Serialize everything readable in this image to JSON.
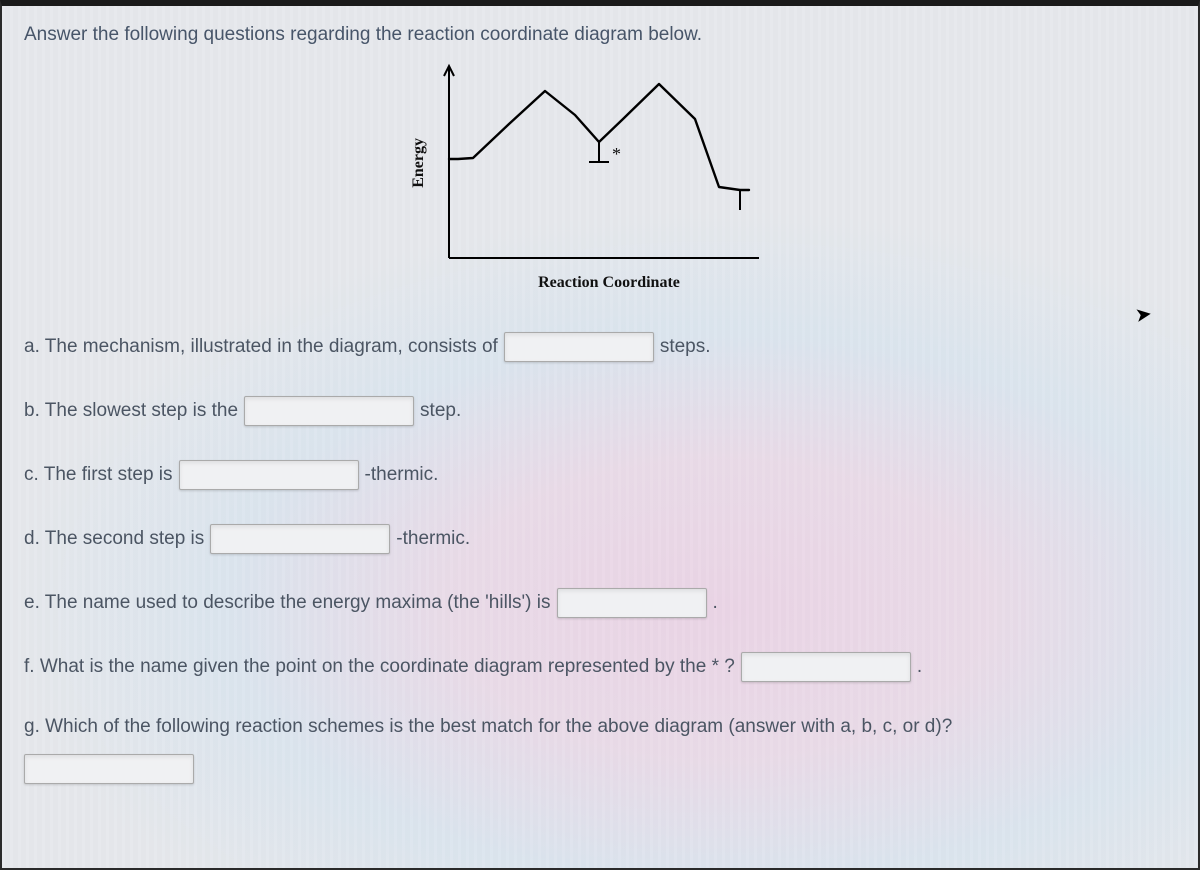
{
  "prompt": "Answer the following questions regarding the reaction coordinate diagram below.",
  "chart_data": {
    "type": "line",
    "xlabel": "Reaction Coordinate",
    "ylabel": "Energy",
    "x": [
      0,
      3,
      8,
      20,
      32,
      42,
      50,
      58,
      70,
      82,
      90,
      97,
      100
    ],
    "values": [
      55,
      55,
      56,
      75,
      93,
      80,
      65,
      78,
      97,
      78,
      40,
      38,
      38
    ],
    "annotations": [
      {
        "label": "*",
        "x": 50,
        "y": 65
      }
    ],
    "intermediate_tick_x": 50,
    "intermediate_tick_y_top": 65,
    "products_tick_x": 97,
    "products_tick_y": 38
  },
  "questions": {
    "a": {
      "pre": "a. The mechanism, illustrated in the diagram, consists of",
      "post": "steps."
    },
    "b": {
      "pre": "b. The slowest step is the",
      "post": "step."
    },
    "c": {
      "pre": "c. The first step is",
      "post": "-thermic."
    },
    "d": {
      "pre": "d. The second step is",
      "post": "-thermic."
    },
    "e": {
      "pre": "e. The name used to describe the energy maxima (the 'hills') is",
      "post": "."
    },
    "f": {
      "pre": "f. What is the name given the point on the coordinate diagram represented by the * ?",
      "post": "."
    },
    "g": {
      "pre": "g. Which of the following reaction schemes is the best match for the above diagram (answer with a, b, c, or d)?"
    }
  }
}
